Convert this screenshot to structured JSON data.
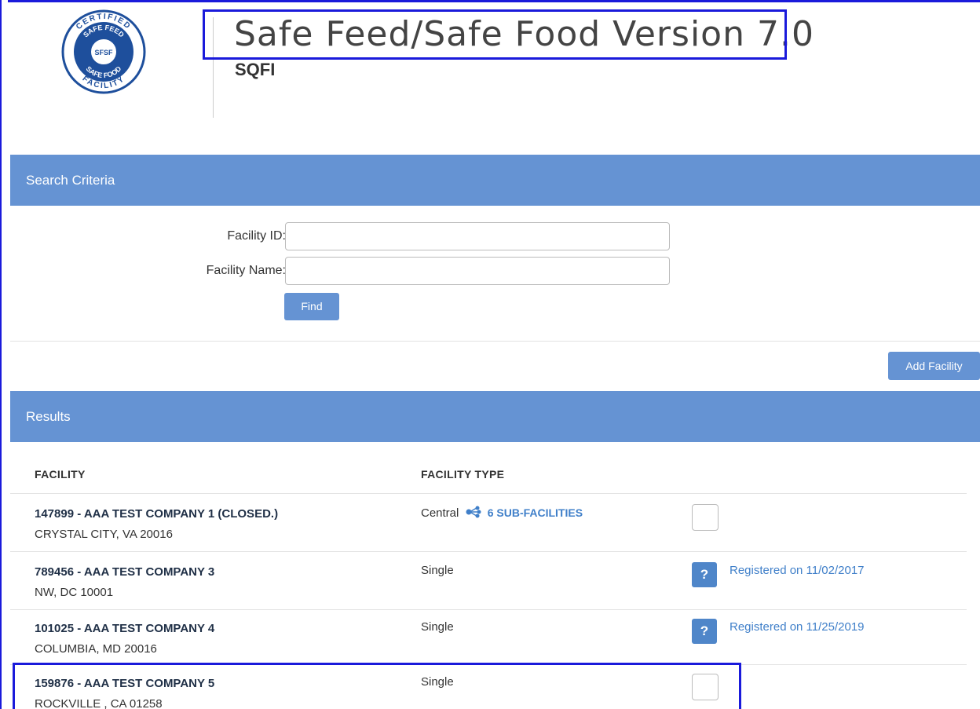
{
  "logo": {
    "text_top": "CERTIFIED",
    "text_mid_top": "SAFE FEED",
    "text_center": "SFSF",
    "text_mid_bottom": "SAFE FOOD",
    "text_bottom": "FACILITY"
  },
  "header": {
    "title": "Safe Feed/Safe Food Version 7.0",
    "subtitle": "SQFI"
  },
  "search": {
    "section_title": "Search Criteria",
    "facility_id_label": "Facility ID:",
    "facility_id_value": "",
    "facility_name_label": "Facility Name:",
    "facility_name_value": "",
    "find_label": "Find"
  },
  "actions": {
    "add_facility_label": "Add Facility"
  },
  "results": {
    "section_title": "Results",
    "columns": {
      "facility": "FACILITY",
      "facility_type": "FACILITY TYPE"
    },
    "rows": [
      {
        "name": "147899 - AAA TEST COMPANY 1 (CLOSED.)",
        "address": "CRYSTAL CITY, VA 20016",
        "type": "Central",
        "sub_facilities": "6 SUB-FACILITIES",
        "status": ""
      },
      {
        "name": "789456 - AAA TEST COMPANY 3",
        "address": "NW, DC 10001",
        "type": "Single",
        "badge": "?",
        "status": "Registered on 11/02/2017"
      },
      {
        "name": "101025 - AAA TEST COMPANY 4",
        "address": "COLUMBIA, MD 20016",
        "type": "Single",
        "badge": "?",
        "status": "Registered on 11/25/2019"
      },
      {
        "name": "159876 - AAA TEST COMPANY 5",
        "address": "ROCKVILLE , CA 01258",
        "type": "Single",
        "status": ""
      }
    ]
  },
  "colors": {
    "accent": "#6593d3",
    "link": "#3f7fc9",
    "highlight": "#1a1adb"
  }
}
